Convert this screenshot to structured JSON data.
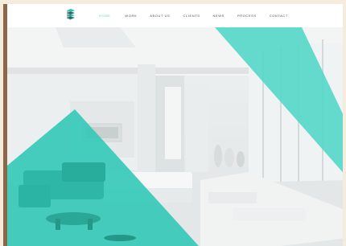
{
  "site": {
    "logo_icon": "layered-cube-logo-icon",
    "accent_color": "#4fd6c6"
  },
  "nav": {
    "items": [
      {
        "label": "HOME",
        "active": true
      },
      {
        "label": "WORK",
        "active": false
      },
      {
        "label": "ABOUT US",
        "active": false
      },
      {
        "label": "CLIENTS",
        "active": false
      },
      {
        "label": "NEWS",
        "active": false
      },
      {
        "label": "PROCESS",
        "active": false
      },
      {
        "label": "CONTACT",
        "active": false
      }
    ]
  },
  "hero": {
    "image": "white-modern-living-room-render",
    "overlay_shapes": [
      "teal-triangle-top-right",
      "teal-triangle-bottom-left"
    ]
  }
}
